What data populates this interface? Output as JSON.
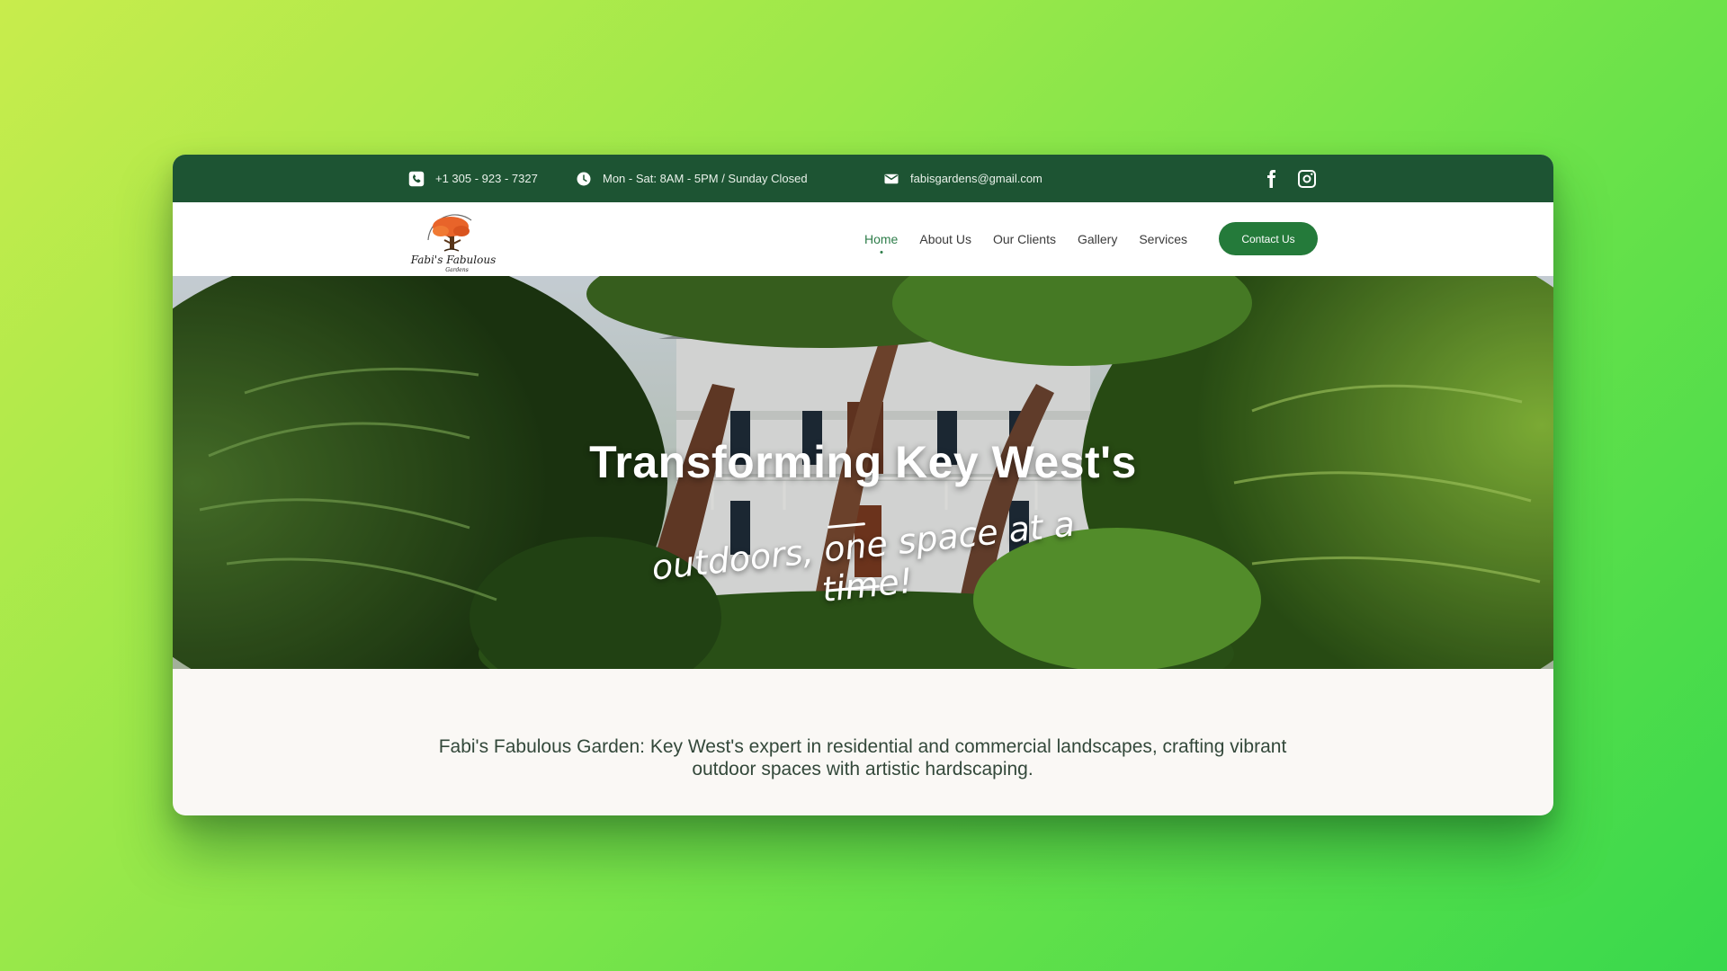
{
  "topbar": {
    "phone": "+1 305 - 923 - 7327",
    "hours": "Mon - Sat: 8AM - 5PM / Sunday Closed",
    "email": "fabisgardens@gmail.com",
    "social": [
      "facebook-icon",
      "instagram-icon"
    ]
  },
  "logo": {
    "text": "Fabi's Fabulous",
    "subtext": "Gardens"
  },
  "nav": {
    "items": [
      {
        "label": "Home",
        "active": true
      },
      {
        "label": "About Us",
        "active": false
      },
      {
        "label": "Our Clients",
        "active": false
      },
      {
        "label": "Gallery",
        "active": false
      },
      {
        "label": "Services",
        "active": false
      }
    ],
    "cta": "Contact Us"
  },
  "hero": {
    "title": "Transforming Key West's",
    "subtitle": "outdoors, one space at a time!"
  },
  "intro": {
    "text": "Fabi's Fabulous Garden: Key West's expert in residential and commercial landscapes, crafting vibrant outdoor spaces with artistic hardscaping."
  },
  "colors": {
    "topbar": "#1d5433",
    "accent": "#247a3a",
    "active_link": "#2e7d4a",
    "background_start": "#c8ec4c",
    "background_end": "#38d84c"
  }
}
